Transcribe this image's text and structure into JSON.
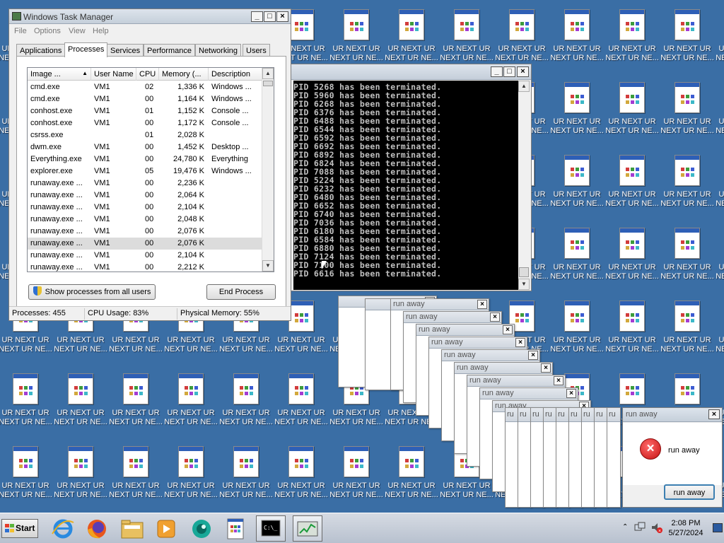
{
  "desktop": {
    "icon_line1": "UR NEXT UR",
    "icon_line2": "NEXT UR NE..."
  },
  "taskmgr": {
    "title": "Windows Task Manager",
    "menu": [
      "File",
      "Options",
      "View",
      "Help"
    ],
    "tabs": [
      "Applications",
      "Processes",
      "Services",
      "Performance",
      "Networking",
      "Users"
    ],
    "active_tab": "Processes",
    "columns": [
      "Image ...",
      "User Name",
      "CPU",
      "Memory (...",
      "Description"
    ],
    "rows": [
      [
        "cmd.exe",
        "VM1",
        "02",
        "1,336 K",
        "Windows ..."
      ],
      [
        "cmd.exe",
        "VM1",
        "00",
        "1,164 K",
        "Windows ..."
      ],
      [
        "conhost.exe",
        "VM1",
        "01",
        "1,152 K",
        "Console ..."
      ],
      [
        "conhost.exe",
        "VM1",
        "00",
        "1,172 K",
        "Console ..."
      ],
      [
        "csrss.exe",
        "",
        "01",
        "2,028 K",
        ""
      ],
      [
        "dwm.exe",
        "VM1",
        "00",
        "1,452 K",
        "Desktop ..."
      ],
      [
        "Everything.exe",
        "VM1",
        "00",
        "24,780 K",
        "Everything"
      ],
      [
        "explorer.exe",
        "VM1",
        "05",
        "19,476 K",
        "Windows ..."
      ],
      [
        "runaway.exe ...",
        "VM1",
        "00",
        "2,236 K",
        ""
      ],
      [
        "runaway.exe ...",
        "VM1",
        "00",
        "2,064 K",
        ""
      ],
      [
        "runaway.exe ...",
        "VM1",
        "00",
        "2,104 K",
        ""
      ],
      [
        "runaway.exe ...",
        "VM1",
        "00",
        "2,048 K",
        ""
      ],
      [
        "runaway.exe ...",
        "VM1",
        "00",
        "2,076 K",
        ""
      ],
      [
        "runaway.exe ...",
        "VM1",
        "00",
        "2,076 K",
        ""
      ],
      [
        "runaway.exe ...",
        "VM1",
        "00",
        "2,104 K",
        ""
      ],
      [
        "runaway.exe ...",
        "VM1",
        "00",
        "2,212 K",
        ""
      ]
    ],
    "selected_row": 13,
    "show_all_label": "Show processes from all users",
    "end_process_label": "End Process",
    "status": {
      "processes": "Processes: 455",
      "cpu": "CPU Usage: 83%",
      "memory": "Physical Memory: 55%"
    }
  },
  "console": {
    "lines": [
      "PID 5268 has been terminated.",
      "PID 5960 has been terminated.",
      "PID 6268 has been terminated.",
      "PID 6376 has been terminated.",
      "PID 6488 has been terminated.",
      "PID 6544 has been terminated.",
      "PID 6592 has been terminated.",
      "PID 6692 has been terminated.",
      "PID 6892 has been terminated.",
      "PID 6824 has been terminated.",
      "PID 7088 has been terminated.",
      "PID 5224 has been terminated.",
      "PID 6232 has been terminated.",
      "PID 6480 has been terminated.",
      "PID 6652 has been terminated.",
      "PID 6740 has been terminated.",
      "PID 7036 has been terminated.",
      "PID 6180 has been terminated.",
      "PID 6584 has been terminated.",
      "PID 6880 has been terminated.",
      "PID 7124 has been terminated.",
      "PID 7100 has been terminated.",
      "PID 6616 has been terminated."
    ]
  },
  "runaway": {
    "title": "run away",
    "message": "run away",
    "button_label": "run away",
    "short_title": "ru"
  },
  "taskbar": {
    "start_label": "Start",
    "time": "2:08 PM",
    "date": "5/27/2024"
  }
}
